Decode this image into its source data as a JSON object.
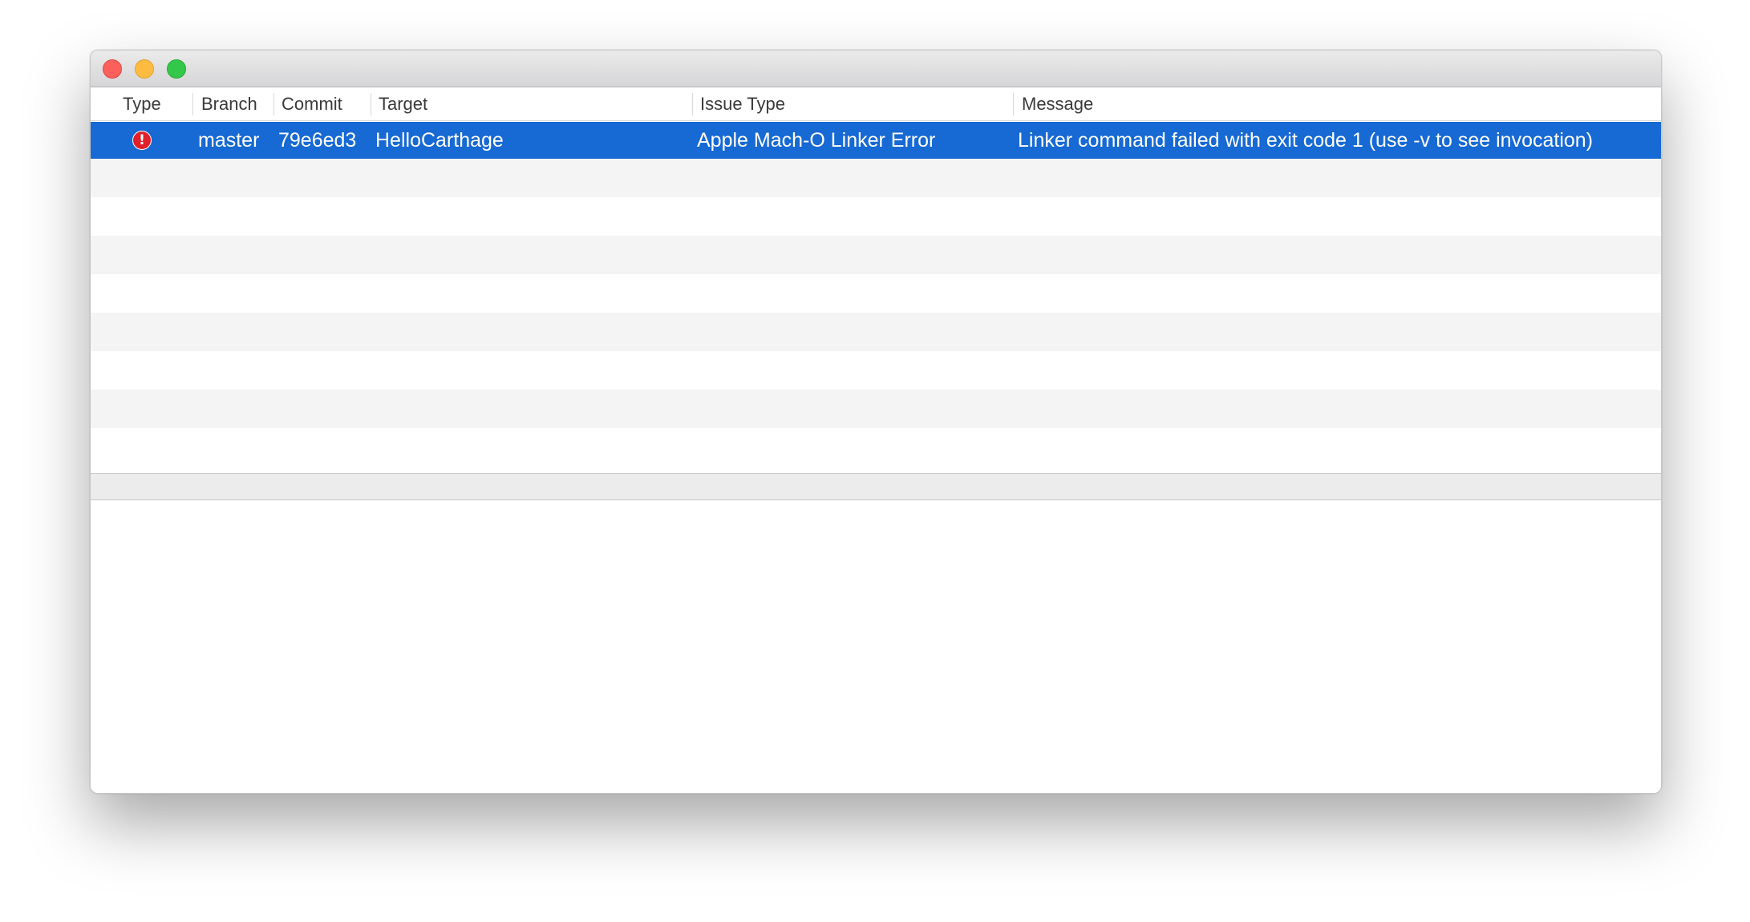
{
  "window": {
    "controls": [
      "close",
      "minimize",
      "zoom"
    ]
  },
  "table": {
    "columns": [
      {
        "key": "type",
        "label": "Type"
      },
      {
        "key": "branch",
        "label": "Branch"
      },
      {
        "key": "commit",
        "label": "Commit"
      },
      {
        "key": "target",
        "label": "Target"
      },
      {
        "key": "issue_type",
        "label": "Issue Type"
      },
      {
        "key": "message",
        "label": "Message"
      }
    ],
    "rows": [
      {
        "type_icon": "error-icon",
        "type_glyph": "!",
        "branch": "master",
        "commit": "79e6ed3",
        "target": "HelloCarthage",
        "issue_type": "Apple Mach-O Linker Error",
        "message": "Linker command failed with exit code 1 (use -v to see invocation)",
        "selected": true
      }
    ],
    "empty_rows": 8
  },
  "colors": {
    "selection": "#1769d3",
    "alternate_row": "#f4f4f4",
    "error": "#e0202a",
    "close": "#fc605b",
    "minimize": "#fdbc40",
    "zoom": "#34c84a"
  }
}
